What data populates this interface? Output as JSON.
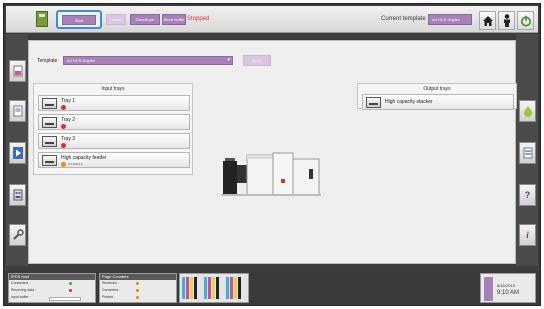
{
  "toolbar": {
    "start_label": "Start",
    "pause_label": "Pause",
    "cancel_label": "Cancel job",
    "store_label": "Store buffer",
    "status": "Stopped",
    "current_template_label": "Current template",
    "current_template_value": "A4 HCS Duplex"
  },
  "main": {
    "template_label": "Template",
    "template_value": "A4 HCS Duplex",
    "apply_label": "Apply",
    "input_title": "Input trays",
    "output_title": "Output trays",
    "input_trays": [
      {
        "name": "Tray 1",
        "status": "error"
      },
      {
        "name": "Tray 2",
        "status": "error"
      },
      {
        "name": "Tray 3",
        "status": "error"
      },
      {
        "name": "High capacity feeder",
        "status": "warning",
        "sub": "A4 250/1.0"
      }
    ],
    "output_trays": [
      {
        "name": "High capacity stacker"
      }
    ]
  },
  "status_bar": {
    "panel1_title": "IPDS host",
    "panel1_rows": [
      "Connected :",
      "Receiving data :",
      "Input buffer :"
    ],
    "panel2_title": "Page Counters",
    "panel2_rows": [
      "Received :",
      "Converted :",
      "Printed :"
    ],
    "date": "8/16/2013",
    "time": "9:10 AM"
  },
  "colors": {
    "accent": "#a782b8",
    "error": "#d8322a",
    "warning": "#e88a1a",
    "ok": "#3aa83a"
  },
  "icons": [
    "machine-icon",
    "home-icon",
    "person-icon",
    "power-icon",
    "question-icon",
    "info-icon",
    "wrench-icon",
    "queue-icon"
  ]
}
